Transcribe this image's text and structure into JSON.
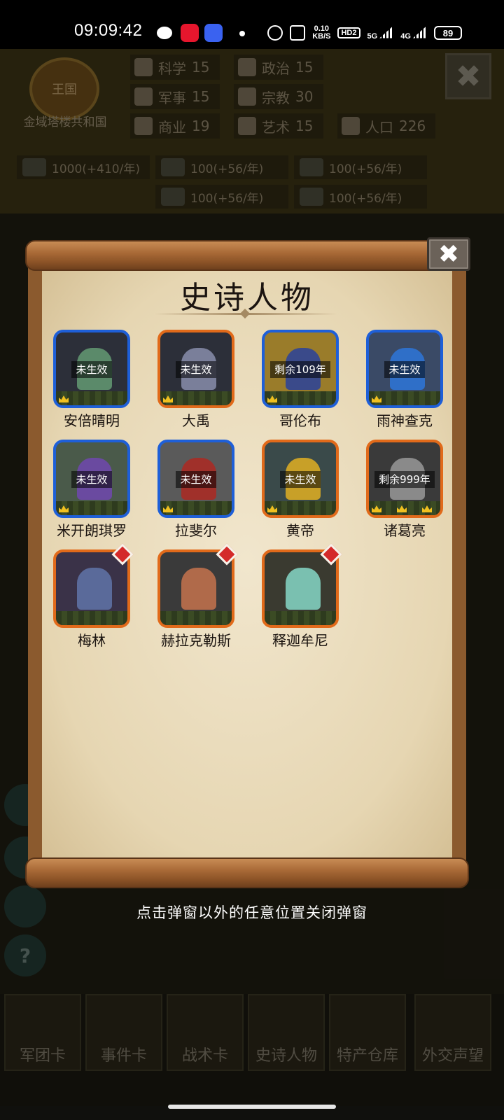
{
  "status_bar": {
    "time": "09:09:42",
    "net_speed_value": "0.10",
    "net_speed_unit": "KB/S",
    "hd": "HD2",
    "signal_1": "5G",
    "signal_2": "4G",
    "battery": "89"
  },
  "background": {
    "emblem_label": "王国",
    "kingdom_name": "金域塔楼共和国",
    "stats": [
      {
        "label": "科学",
        "value": "15"
      },
      {
        "label": "政治",
        "value": "15"
      },
      {
        "label": "军事",
        "value": "15"
      },
      {
        "label": "宗教",
        "value": "30"
      },
      {
        "label": "商业",
        "value": "19"
      },
      {
        "label": "艺术",
        "value": "15"
      },
      {
        "label": "人口",
        "value": "226"
      }
    ],
    "resources": [
      "1000(+410/年)",
      "100(+56/年)",
      "100(+56/年)",
      "100(+56/年)",
      "100(+56/年)"
    ],
    "tabs": [
      "军团卡",
      "事件卡",
      "战术卡",
      "史诗人物",
      "特产仓库",
      "外交声望"
    ]
  },
  "modal": {
    "title": "史诗人物",
    "close_glyph": "✖",
    "characters": [
      {
        "name": "安倍晴明",
        "status": "未生效",
        "frame": "blue"
      },
      {
        "name": "大禹",
        "status": "未生效",
        "frame": "orange"
      },
      {
        "name": "哥伦布",
        "status": "剩余109年",
        "frame": "blue"
      },
      {
        "name": "雨神查克",
        "status": "未生效",
        "frame": "blue"
      },
      {
        "name": "米开朗琪罗",
        "status": "未生效",
        "frame": "blue"
      },
      {
        "name": "拉斐尔",
        "status": "未生效",
        "frame": "blue"
      },
      {
        "name": "黄帝",
        "status": "未生效",
        "frame": "orange"
      },
      {
        "name": "诸葛亮",
        "status": "剩余999年",
        "frame": "orange"
      },
      {
        "name": "梅林",
        "status": "",
        "frame": "orange",
        "new_badge": true
      },
      {
        "name": "赫拉克勒斯",
        "status": "",
        "frame": "orange",
        "new_badge": true
      },
      {
        "name": "释迦牟尼",
        "status": "",
        "frame": "orange",
        "new_badge": true
      }
    ]
  },
  "hint": "点击弹窗以外的任意位置关闭弹窗",
  "colors": {
    "frame_blue": "#1e5fd8",
    "frame_orange": "#e16a1a",
    "badge_red": "#d42a2a",
    "paper": "#ecdfc1",
    "wood": "#a96a37"
  }
}
